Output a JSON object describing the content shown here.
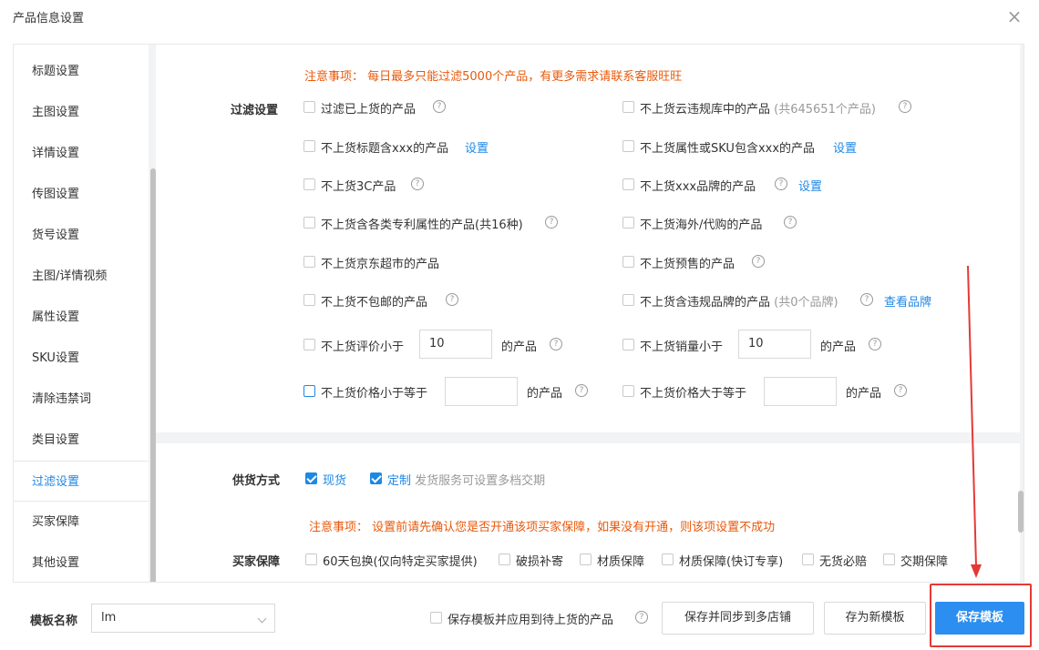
{
  "dialog": {
    "title": "产品信息设置",
    "close_icon": "close-icon"
  },
  "sidebar": {
    "items": [
      "标题设置",
      "主图设置",
      "详情设置",
      "传图设置",
      "货号设置",
      "主图/详情视频",
      "属性设置",
      "SKU设置",
      "清除违禁词",
      "类目设置",
      "过滤设置",
      "买家保障",
      "其他设置"
    ],
    "active": "过滤设置"
  },
  "filter": {
    "notice": "注意事项： 每日最多只能过滤5000个产品，有更多需求请联系客服旺旺",
    "section_label": "过滤设置",
    "left": {
      "r1": "过滤已上货的产品",
      "r2": "不上货标题含xxx的产品",
      "r2_link": "设置",
      "r3": "不上货3C产品",
      "r4": "不上货含各类专利属性的产品(共16种)",
      "r5": "不上货京东超市的产品",
      "r6": "不上货不包邮的产品",
      "r7_prefix": "不上货评价小于",
      "r7_value": "10",
      "r7_suffix": "的产品",
      "r8_prefix": "不上货价格小于等于",
      "r8_value": "",
      "r8_suffix": "的产品"
    },
    "right": {
      "r1": "不上货云违规库中的产品",
      "r1_note": "(共645651个产品)",
      "r2": "不上货属性或SKU包含xxx的产品",
      "r2_link": "设置",
      "r3": "不上货xxx品牌的产品",
      "r3_link": "设置",
      "r4": "不上货海外/代购的产品",
      "r5": "不上货预售的产品",
      "r6": "不上货含违规品牌的产品",
      "r6_note": "(共0个品牌)",
      "r6_link": "查看品牌",
      "r7_prefix": "不上货销量小于",
      "r7_value": "10",
      "r7_suffix": "的产品",
      "r8_prefix": "不上货价格大于等于",
      "r8_value": "",
      "r8_suffix": "的产品"
    },
    "help_icon": "?"
  },
  "supply": {
    "section_label": "供货方式",
    "opt1": "现货",
    "opt2": "定制",
    "opt2_note": "发货服务可设置多档交期"
  },
  "guarantee": {
    "notice": "注意事项： 设置前请先确认您是否开通该项买家保障，如果没有开通，则该项设置不成功",
    "section_label": "买家保障",
    "options": [
      "60天包换(仅向特定买家提供)",
      "破损补寄",
      "材质保障",
      "材质保障(快订专享)",
      "无货必赔",
      "交期保障"
    ]
  },
  "footer": {
    "template_label": "模板名称",
    "template_value": "lm",
    "apply_checkbox_label": "保存模板并应用到待上货的产品",
    "sync_button": "保存并同步到多店铺",
    "new_template_button": "存为新模板",
    "save_button": "保存模板"
  },
  "colors": {
    "accent": "#2b8ef0",
    "notice": "#e8590c",
    "highlight": "#e53935"
  }
}
